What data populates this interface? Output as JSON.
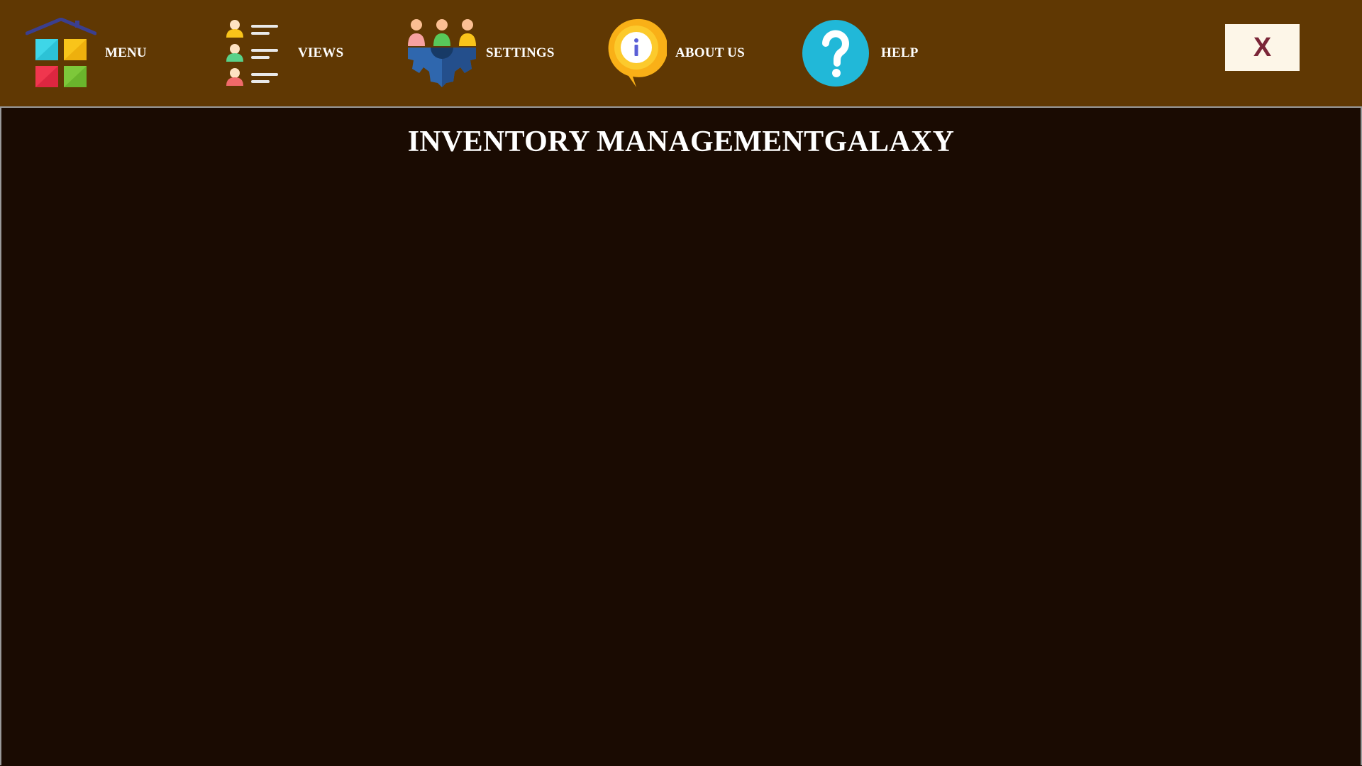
{
  "toolbar": {
    "background_color": "#603803",
    "items": [
      {
        "id": "menu",
        "label": "MENU",
        "icon": "home-grid-icon"
      },
      {
        "id": "views",
        "label": "VIEWS",
        "icon": "user-list-icon"
      },
      {
        "id": "settings",
        "label": "SETTINGS",
        "icon": "team-gear-icon"
      },
      {
        "id": "about",
        "label": "ABOUT US",
        "icon": "info-pin-icon"
      },
      {
        "id": "help",
        "label": "HELP",
        "icon": "question-circle-icon"
      }
    ],
    "close_label": "X"
  },
  "main": {
    "title": "INVENTORY MANAGEMENTGALAXY",
    "background_color": "#1a0b02"
  }
}
